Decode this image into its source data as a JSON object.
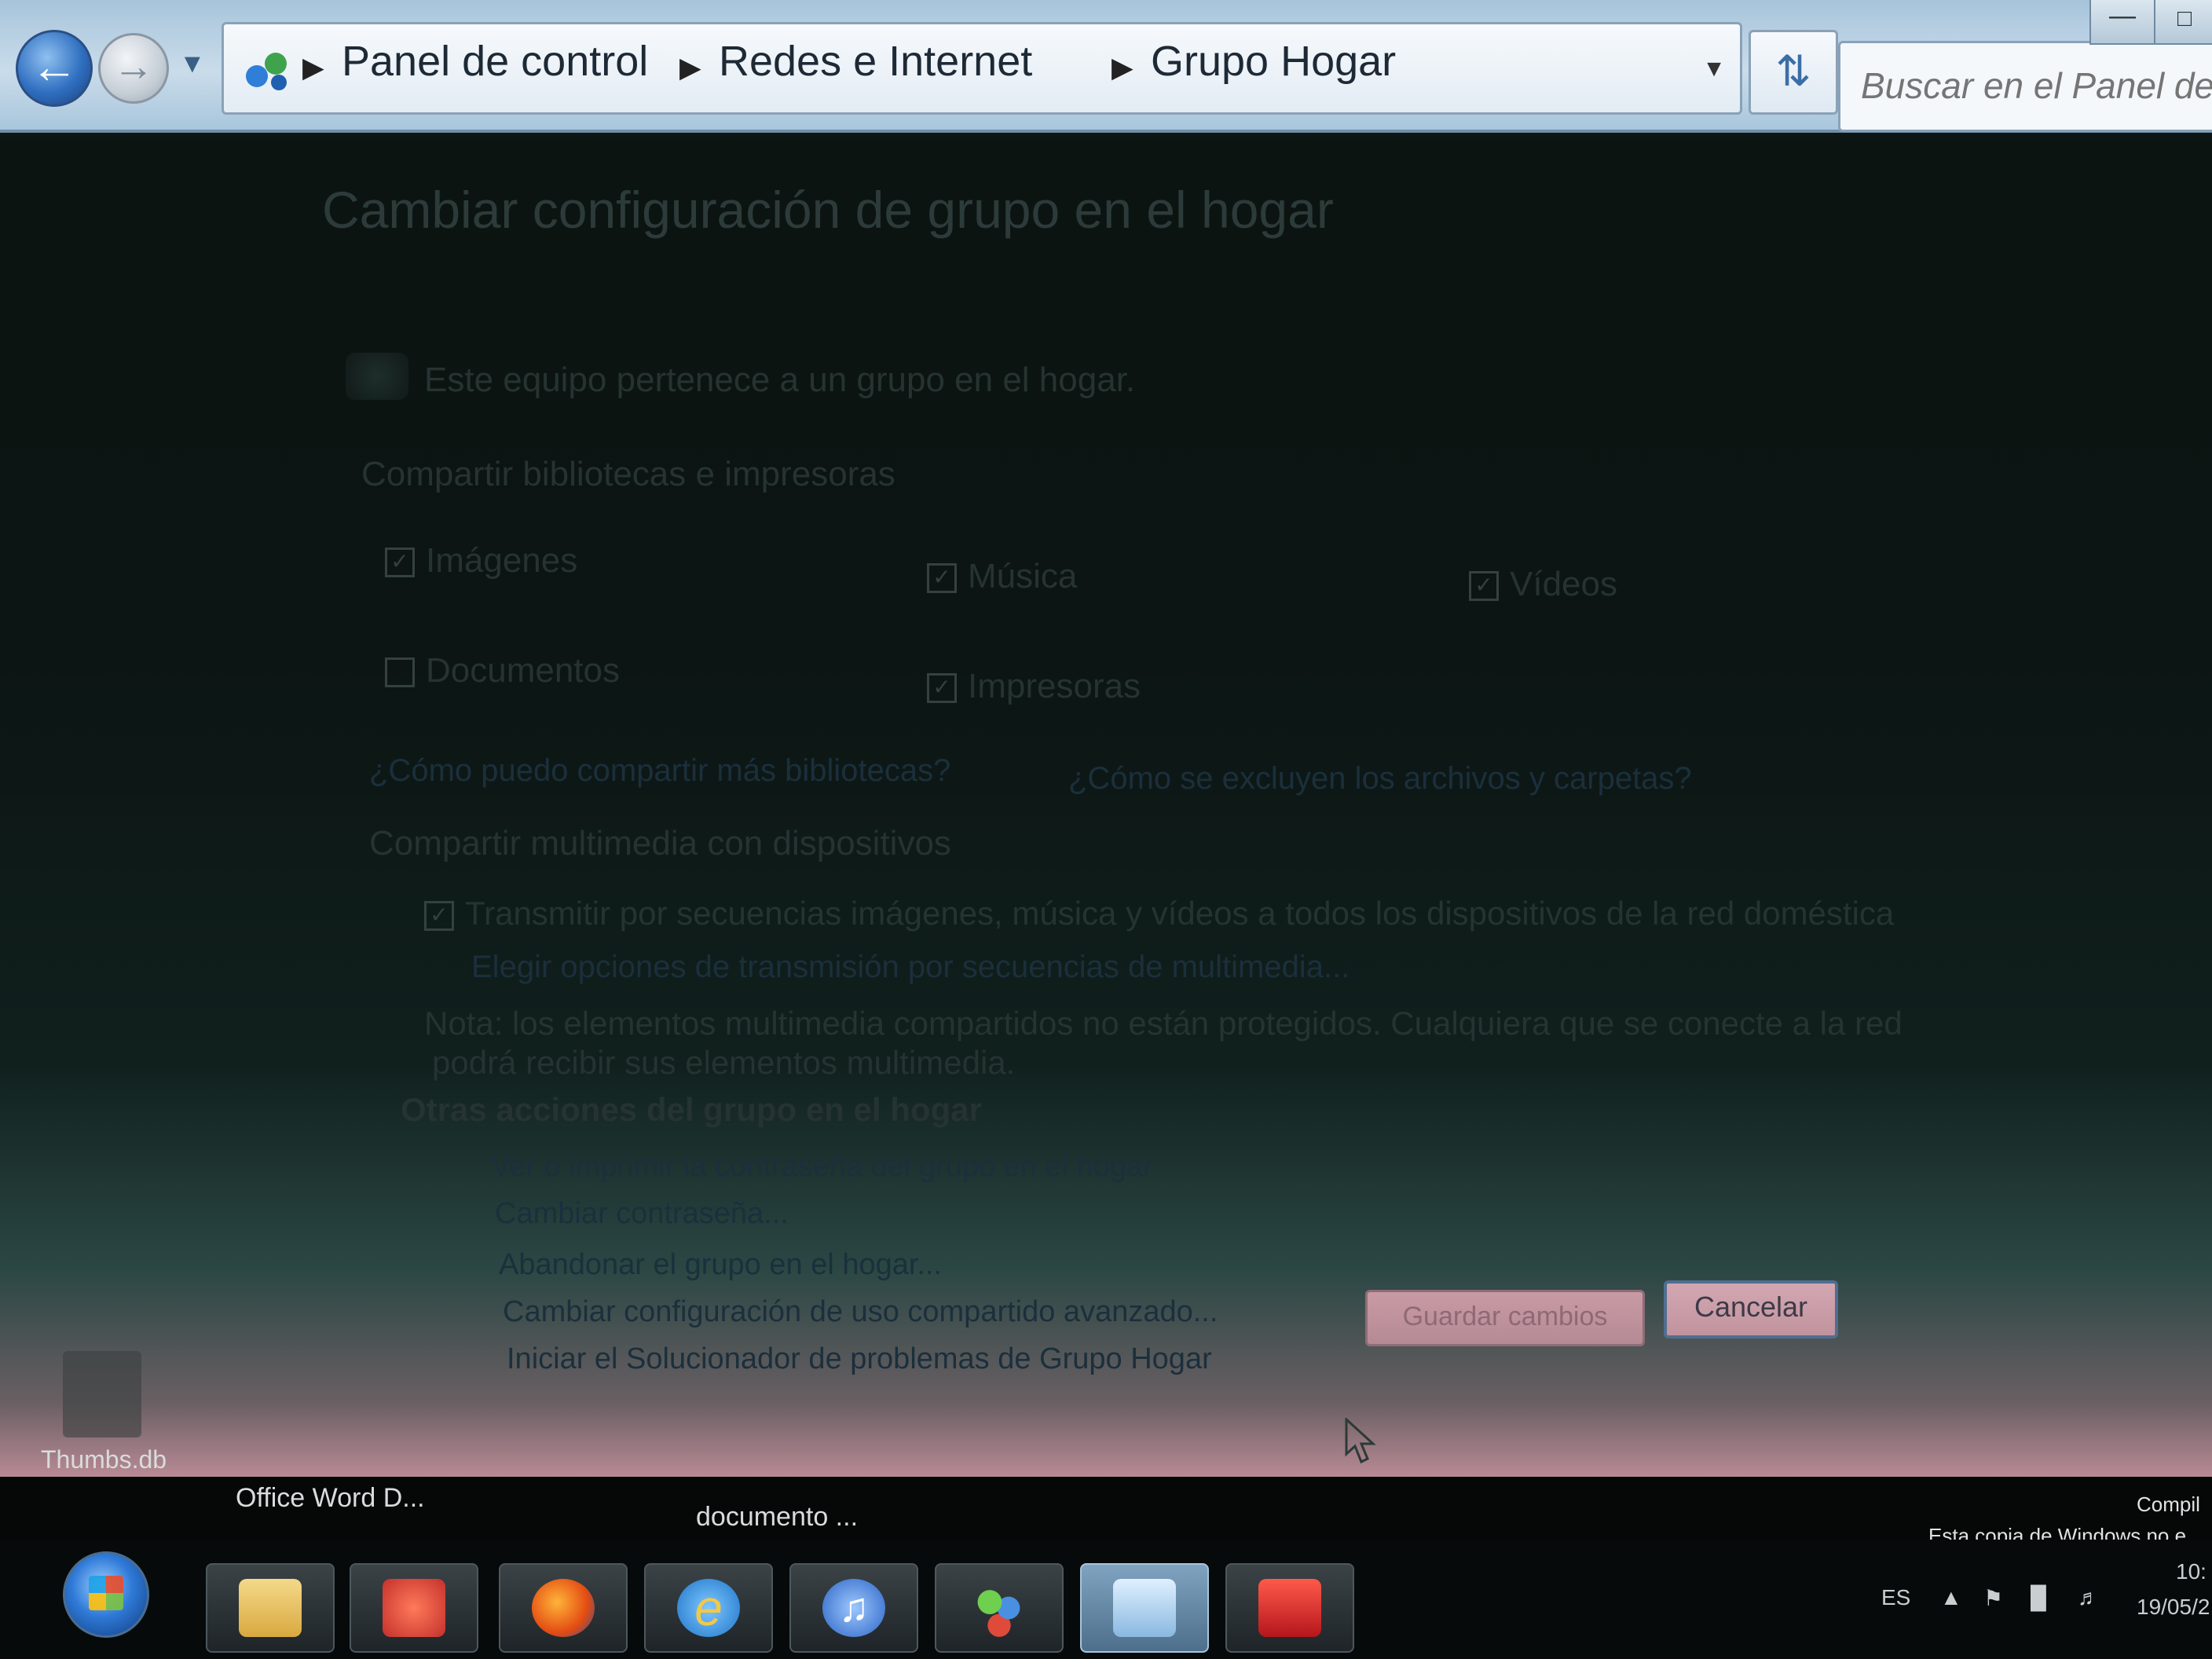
{
  "window": {
    "breadcrumb": [
      "Panel de control",
      "Redes e Internet",
      "Grupo Hogar"
    ],
    "search_placeholder": "Buscar en el Panel de control"
  },
  "content": {
    "title": "Cambiar configuración de grupo en el hogar",
    "status": "Este equipo pertenece a un grupo en el hogar.",
    "share_heading": "Compartir bibliotecas e impresoras",
    "share_items": [
      {
        "label": "Imágenes",
        "checked": true
      },
      {
        "label": "Música",
        "checked": true
      },
      {
        "label": "Vídeos",
        "checked": true
      },
      {
        "label": "Documentos",
        "checked": false
      },
      {
        "label": "Impresoras",
        "checked": true
      }
    ],
    "help_link_1": "¿Cómo puedo compartir más bibliotecas?",
    "help_link_2": "¿Cómo se excluyen los archivos y carpetas?",
    "media_heading": "Compartir multimedia con dispositivos",
    "media_checkbox": "Transmitir por secuencias imágenes, música y vídeos a todos los dispositivos de la red doméstica",
    "media_link": "Elegir opciones de transmisión por secuencias de multimedia...",
    "note_line_1": "Nota: los elementos multimedia compartidos no están protegidos. Cualquiera que se conecte a la red",
    "note_line_2": "podrá recibir sus elementos multimedia.",
    "other_heading": "Otras acciones del grupo en el hogar",
    "actions": [
      "Ver o imprimir la contraseña del grupo en el hogar",
      "Cambiar contraseña...",
      "Abandonar el grupo en el hogar...",
      "Cambiar configuración de uso compartido avanzado...",
      "Iniciar el Solucionador de problemas de Grupo Hogar"
    ],
    "save_button": "Guardar cambios",
    "cancel_button": "Cancelar"
  },
  "desktop": {
    "file_label": "Thumbs.db",
    "label_word": "Office Word D...",
    "label_doc": "documento ...",
    "watermark_1": "Compil",
    "watermark_2": "Esta copia de Windows no e"
  },
  "taskbar": {
    "apps": [
      "explorer-icon",
      "media-player-icon",
      "firefox-icon",
      "internet-explorer-icon",
      "itunes-icon",
      "messenger-icon",
      "control-panel-icon",
      "acrobat-icon"
    ],
    "language": "ES",
    "clock_time": "10:",
    "clock_date": "19/05/2"
  },
  "colors": {
    "titlebar": "#c9dcea",
    "content_dark": "#0c1513",
    "bottom_tint": "#b98a95"
  }
}
